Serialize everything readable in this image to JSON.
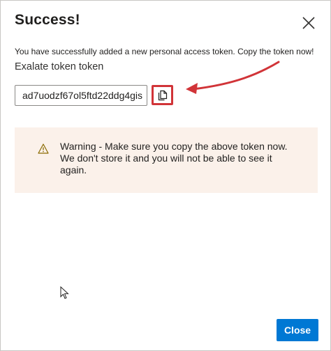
{
  "dialog": {
    "title": "Success!",
    "close_icon": "close-icon",
    "message": "You have successfully added a new personal access token. Copy the token now!",
    "token_name": "Exalate token token",
    "token_value": "ad7uodzf67ol5ftd22ddg4gis",
    "copy_icon": "copy-icon",
    "highlight_color": "#d13438",
    "warning": {
      "icon": "warning-icon",
      "text": "Warning - Make sure you copy the above token now. We don't store it and you will not be able to see it again.",
      "background": "#fbf1ea"
    },
    "close_button_label": "Close",
    "accent_color": "#0078d4"
  }
}
